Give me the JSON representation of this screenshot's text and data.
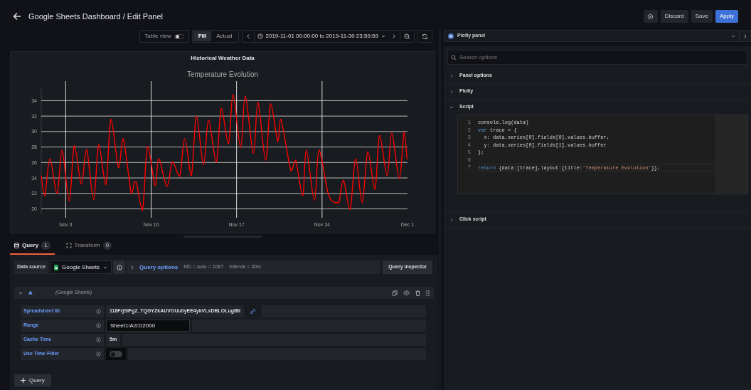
{
  "header": {
    "title": "Google Sheets Dashboard / Edit Panel",
    "buttons": [
      {
        "label": "Discard",
        "kind": "secondary"
      },
      {
        "label": "Save",
        "kind": "secondary"
      },
      {
        "label": "Apply",
        "kind": "primary"
      }
    ]
  },
  "toolbar": {
    "table_view": {
      "label": "Table view",
      "on": false
    },
    "display_modes": [
      {
        "label": "Fill",
        "selected": true
      },
      {
        "label": "Actual",
        "selected": false
      }
    ],
    "time_range": "2019-11-01 00:00:00 to 2019-11-30 23:59:59"
  },
  "panel": {
    "title": "Historical Weather Data",
    "chart_data": {
      "type": "line",
      "title": "Temperature Evolution",
      "x": [
        "2019-11-01 00:00",
        "2019-11-01 07:00",
        "2019-11-01 17:00",
        "2019-11-02 07:00",
        "2019-11-02 17:00",
        "2019-11-03 07:00",
        "2019-11-03 17:00",
        "2019-11-04 07:00",
        "2019-11-04 17:00",
        "2019-11-05 07:00",
        "2019-11-05 17:00",
        "2019-11-06 07:00",
        "2019-11-06 17:00",
        "2019-11-07 08:00",
        "2019-11-07 17:00",
        "2019-11-08 09:00",
        "2019-11-08 15:00",
        "2019-11-08 19:00",
        "2019-11-09 07:00",
        "2019-11-09 17:00",
        "2019-11-10 08:00",
        "2019-11-10 15:00",
        "2019-11-11 07:00",
        "2019-11-11 18:00",
        "2019-11-12 08:00",
        "2019-11-12 18:00",
        "2019-11-13 07:00",
        "2019-11-13 17:00",
        "2019-11-14 07:00",
        "2019-11-14 17:00",
        "2019-11-15 08:00",
        "2019-11-15 18:00",
        "2019-11-16 08:00",
        "2019-11-16 17:00",
        "2019-11-17 08:00",
        "2019-11-17 17:00",
        "2019-11-18 09:00",
        "2019-11-18 18:00",
        "2019-11-19 09:00",
        "2019-11-19 19:00",
        "2019-11-20 09:00",
        "2019-11-20 15:00",
        "2019-11-21 11:00",
        "2019-11-21 20:00",
        "2019-11-22 10:00",
        "2019-11-22 17:00",
        "2019-11-23 09:00",
        "2019-11-23 18:00",
        "2019-11-24 12:00",
        "2019-11-25 01:00",
        "2019-11-25 09:00",
        "2019-11-25 18:00",
        "2019-11-26 07:00",
        "2019-11-26 18:00",
        "2019-11-27 07:00",
        "2019-11-27 18:00",
        "2019-11-28 08:00",
        "2019-11-28 17:00",
        "2019-11-29 08:00",
        "2019-11-29 17:00",
        "2019-11-30 08:00",
        "2019-11-30 17:00",
        "2019-11-30 23:00"
      ],
      "series": [
        {
          "color": "#ff0000",
          "values": [
            24.3,
            21.7,
            26.5,
            22,
            27.6,
            21,
            28.2,
            23.2,
            27.7,
            21.2,
            28.3,
            23.1,
            31.6,
            25.3,
            29.1,
            22,
            23.5,
            23.4,
            19.8,
            28.1,
            23,
            26.5,
            22.9,
            26.1,
            24.2,
            29.1,
            24.3,
            32,
            25.7,
            31.5,
            26,
            33,
            28.4,
            34.8,
            27.9,
            34.6,
            27.2,
            33.8,
            26.3,
            33.6,
            28.7,
            31.6,
            24.9,
            26.3,
            21.7,
            27.6,
            21.1,
            27.6,
            22,
            20.8,
            20.8,
            23.7,
            19.9,
            26.5,
            20.8,
            27.4,
            22.5,
            29.5,
            24.3,
            29.8,
            23.9,
            29.9,
            26.4
          ]
        }
      ],
      "xlim": [
        "2019-11-01",
        "2019-12-01"
      ],
      "grid": true,
      "ylim": [
        19.4,
        35.6
      ],
      "xticks": [
        {
          "value": "2019-11-03",
          "label": "Nov 3"
        },
        {
          "value": "2019-11-10",
          "label": "Nov 10"
        },
        {
          "value": "2019-11-17",
          "label": "Nov 17"
        },
        {
          "value": "2019-11-24",
          "label": "Nov 24"
        },
        {
          "value": "2019-12-01",
          "label": "Dec 1"
        }
      ],
      "yticks": [
        20,
        22,
        24,
        26,
        28,
        30,
        32,
        34
      ]
    }
  },
  "query_tabs": [
    {
      "label": "Query",
      "count": "1",
      "selected": true
    },
    {
      "label": "Transform",
      "count": "0",
      "selected": false
    }
  ],
  "data_source": {
    "label": "Data source",
    "value": "Google Sheets",
    "query_options": "Query options",
    "max_data_points": "MD = auto = 1087",
    "interval": "Interval = 30m",
    "inspector": "Query inspector"
  },
  "query": {
    "name": "A",
    "source": "(Google Sheets)",
    "expanded": true,
    "fields": [
      {
        "label": "Spreadsheet ID",
        "kind": "text",
        "value": "118FrjSIFg2_TQGYZkAUVOUu0yEE4ykVLxDBLOLugIBI",
        "link": true,
        "focused": false
      },
      {
        "label": "Range",
        "kind": "text",
        "value": "Sheet1!A3:D2000",
        "focused": true
      },
      {
        "label": "Cache Time",
        "kind": "text",
        "value": "5m",
        "focused": false
      },
      {
        "label": "Use Time Filter",
        "kind": "switch",
        "on": false
      }
    ]
  },
  "add_query": "Query",
  "options": {
    "visualization": "Plotly panel",
    "search_placeholder": "Search options",
    "sections": [
      {
        "label": "Panel options",
        "expanded": false
      },
      {
        "label": "Plotly",
        "expanded": false
      },
      {
        "label": "Script",
        "expanded": true,
        "code": [
          {
            "number": "1",
            "tokens": [
              {
                "kind": "plain",
                "text": "console.log(data)"
              }
            ]
          },
          {
            "number": "2",
            "tokens": [
              {
                "kind": "keyword",
                "text": "var"
              },
              {
                "kind": "plain",
                "text": " trace = {"
              }
            ]
          },
          {
            "number": "3",
            "tokens": [
              {
                "kind": "plain",
                "text": "  x: data.series[0].fields[0].values.buffer,"
              }
            ]
          },
          {
            "number": "4",
            "tokens": [
              {
                "kind": "plain",
                "text": "  y: data.series[0].fields[1].values.buffer"
              }
            ]
          },
          {
            "number": "5",
            "tokens": [
              {
                "kind": "plain",
                "text": "};"
              }
            ]
          },
          {
            "number": "6"
          },
          {
            "number": "7",
            "tokens": [
              {
                "kind": "keyword",
                "text": "return"
              },
              {
                "kind": "plain",
                "text": " {data:[trace],layout:{title:"
              },
              {
                "kind": "string",
                "text": "'Temperature Evolution'"
              },
              {
                "kind": "plain",
                "text": "}};"
              }
            ]
          }
        ]
      },
      {
        "label": "Click script",
        "expanded": false
      }
    ]
  }
}
